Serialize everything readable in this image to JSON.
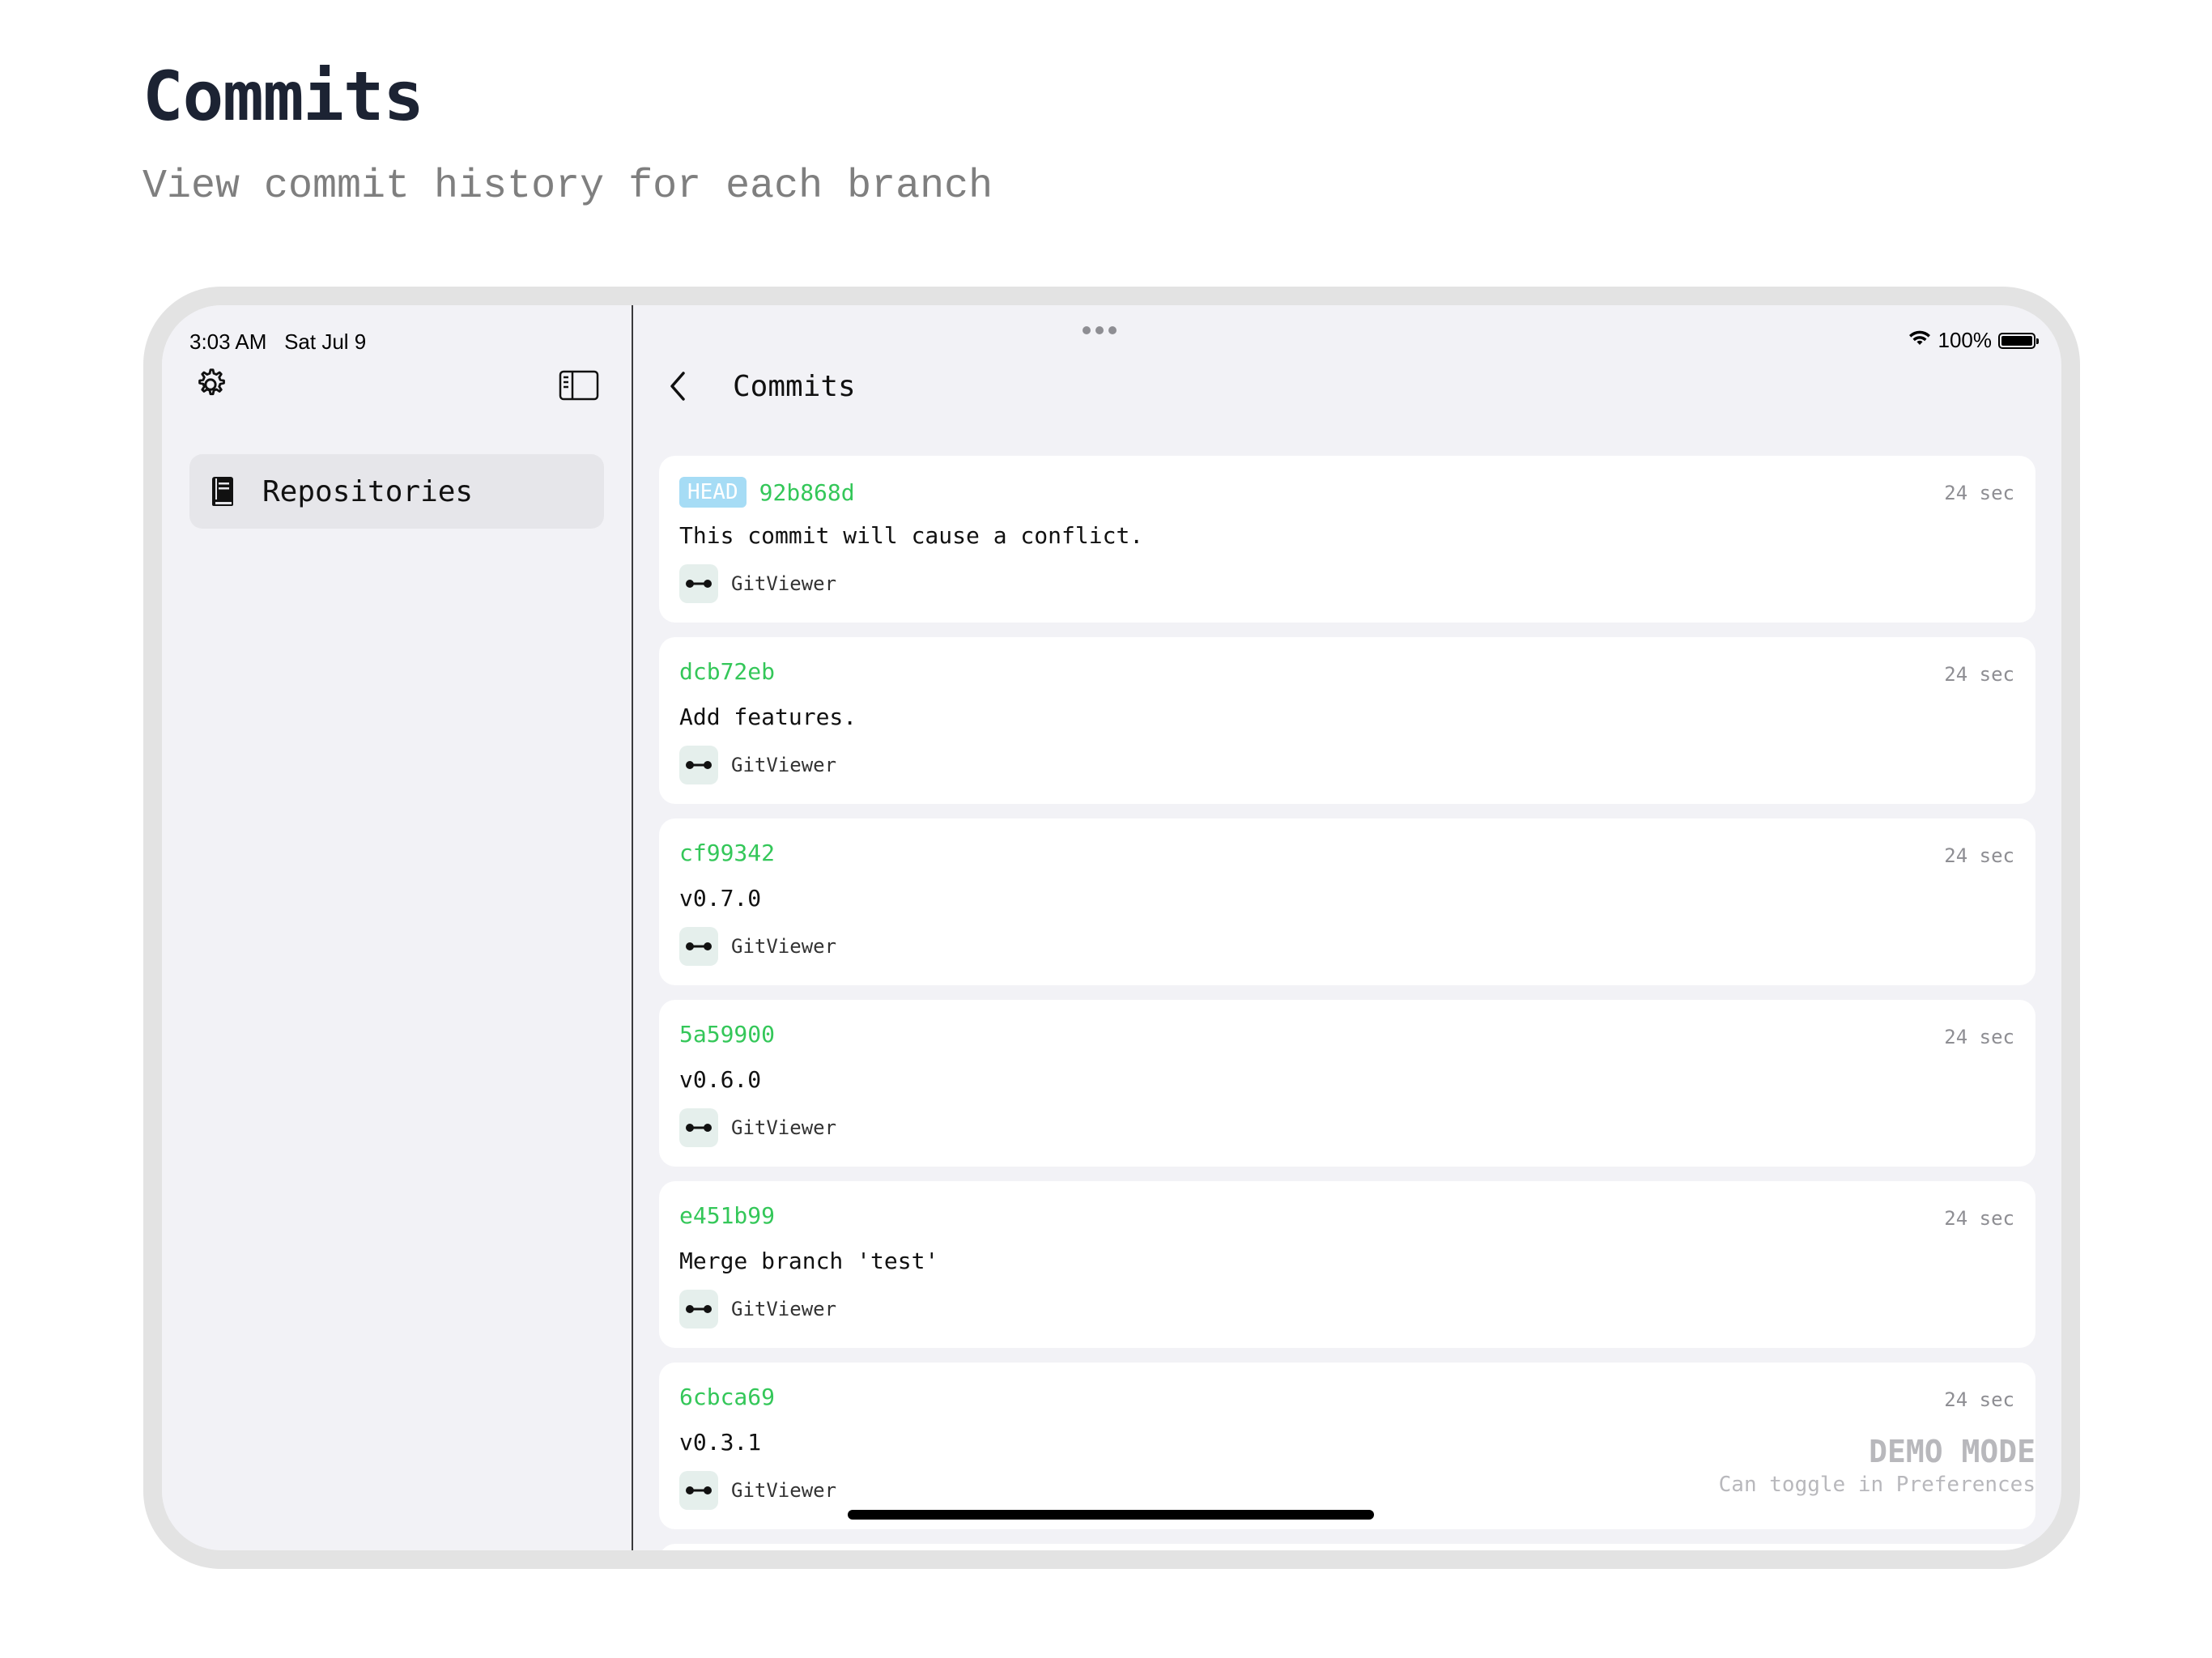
{
  "hero": {
    "title": "Commits",
    "subtitle": "View commit history for each branch"
  },
  "status_bar": {
    "time_date": "3:03 AM   Sat Jul 9",
    "battery": "100%",
    "battery_level": 1.0
  },
  "sidebar": {
    "settings_icon": "gear-icon",
    "toggle_icon": "sidebar-toggle-icon",
    "items": [
      {
        "label": "Repositories",
        "icon": "book-icon"
      }
    ]
  },
  "nav": {
    "back_icon": "chevron-left-icon",
    "title": "Commits"
  },
  "commits": [
    {
      "badge": "HEAD",
      "sha": "92b868d",
      "message": "This commit will cause a conflict.",
      "author": "GitViewer",
      "age": "24 sec"
    },
    {
      "badge": "",
      "sha": "dcb72eb",
      "message": "Add features.",
      "author": "GitViewer",
      "age": "24 sec"
    },
    {
      "badge": "",
      "sha": "cf99342",
      "message": "v0.7.0",
      "author": "GitViewer",
      "age": "24 sec"
    },
    {
      "badge": "",
      "sha": "5a59900",
      "message": "v0.6.0",
      "author": "GitViewer",
      "age": "24 sec"
    },
    {
      "badge": "",
      "sha": "e451b99",
      "message": "Merge branch 'test'",
      "author": "GitViewer",
      "age": "24 sec"
    },
    {
      "badge": "",
      "sha": "6cbca69",
      "message": "v0.3.1",
      "author": "GitViewer",
      "age": "24 sec"
    }
  ],
  "demo": {
    "title": "DEMO MODE",
    "subtitle": "Can toggle in Preferences"
  },
  "colors": {
    "sha": "#34c759",
    "badge_bg": "#a6dcf5",
    "background": "#f2f2f6",
    "card": "#ffffff"
  }
}
